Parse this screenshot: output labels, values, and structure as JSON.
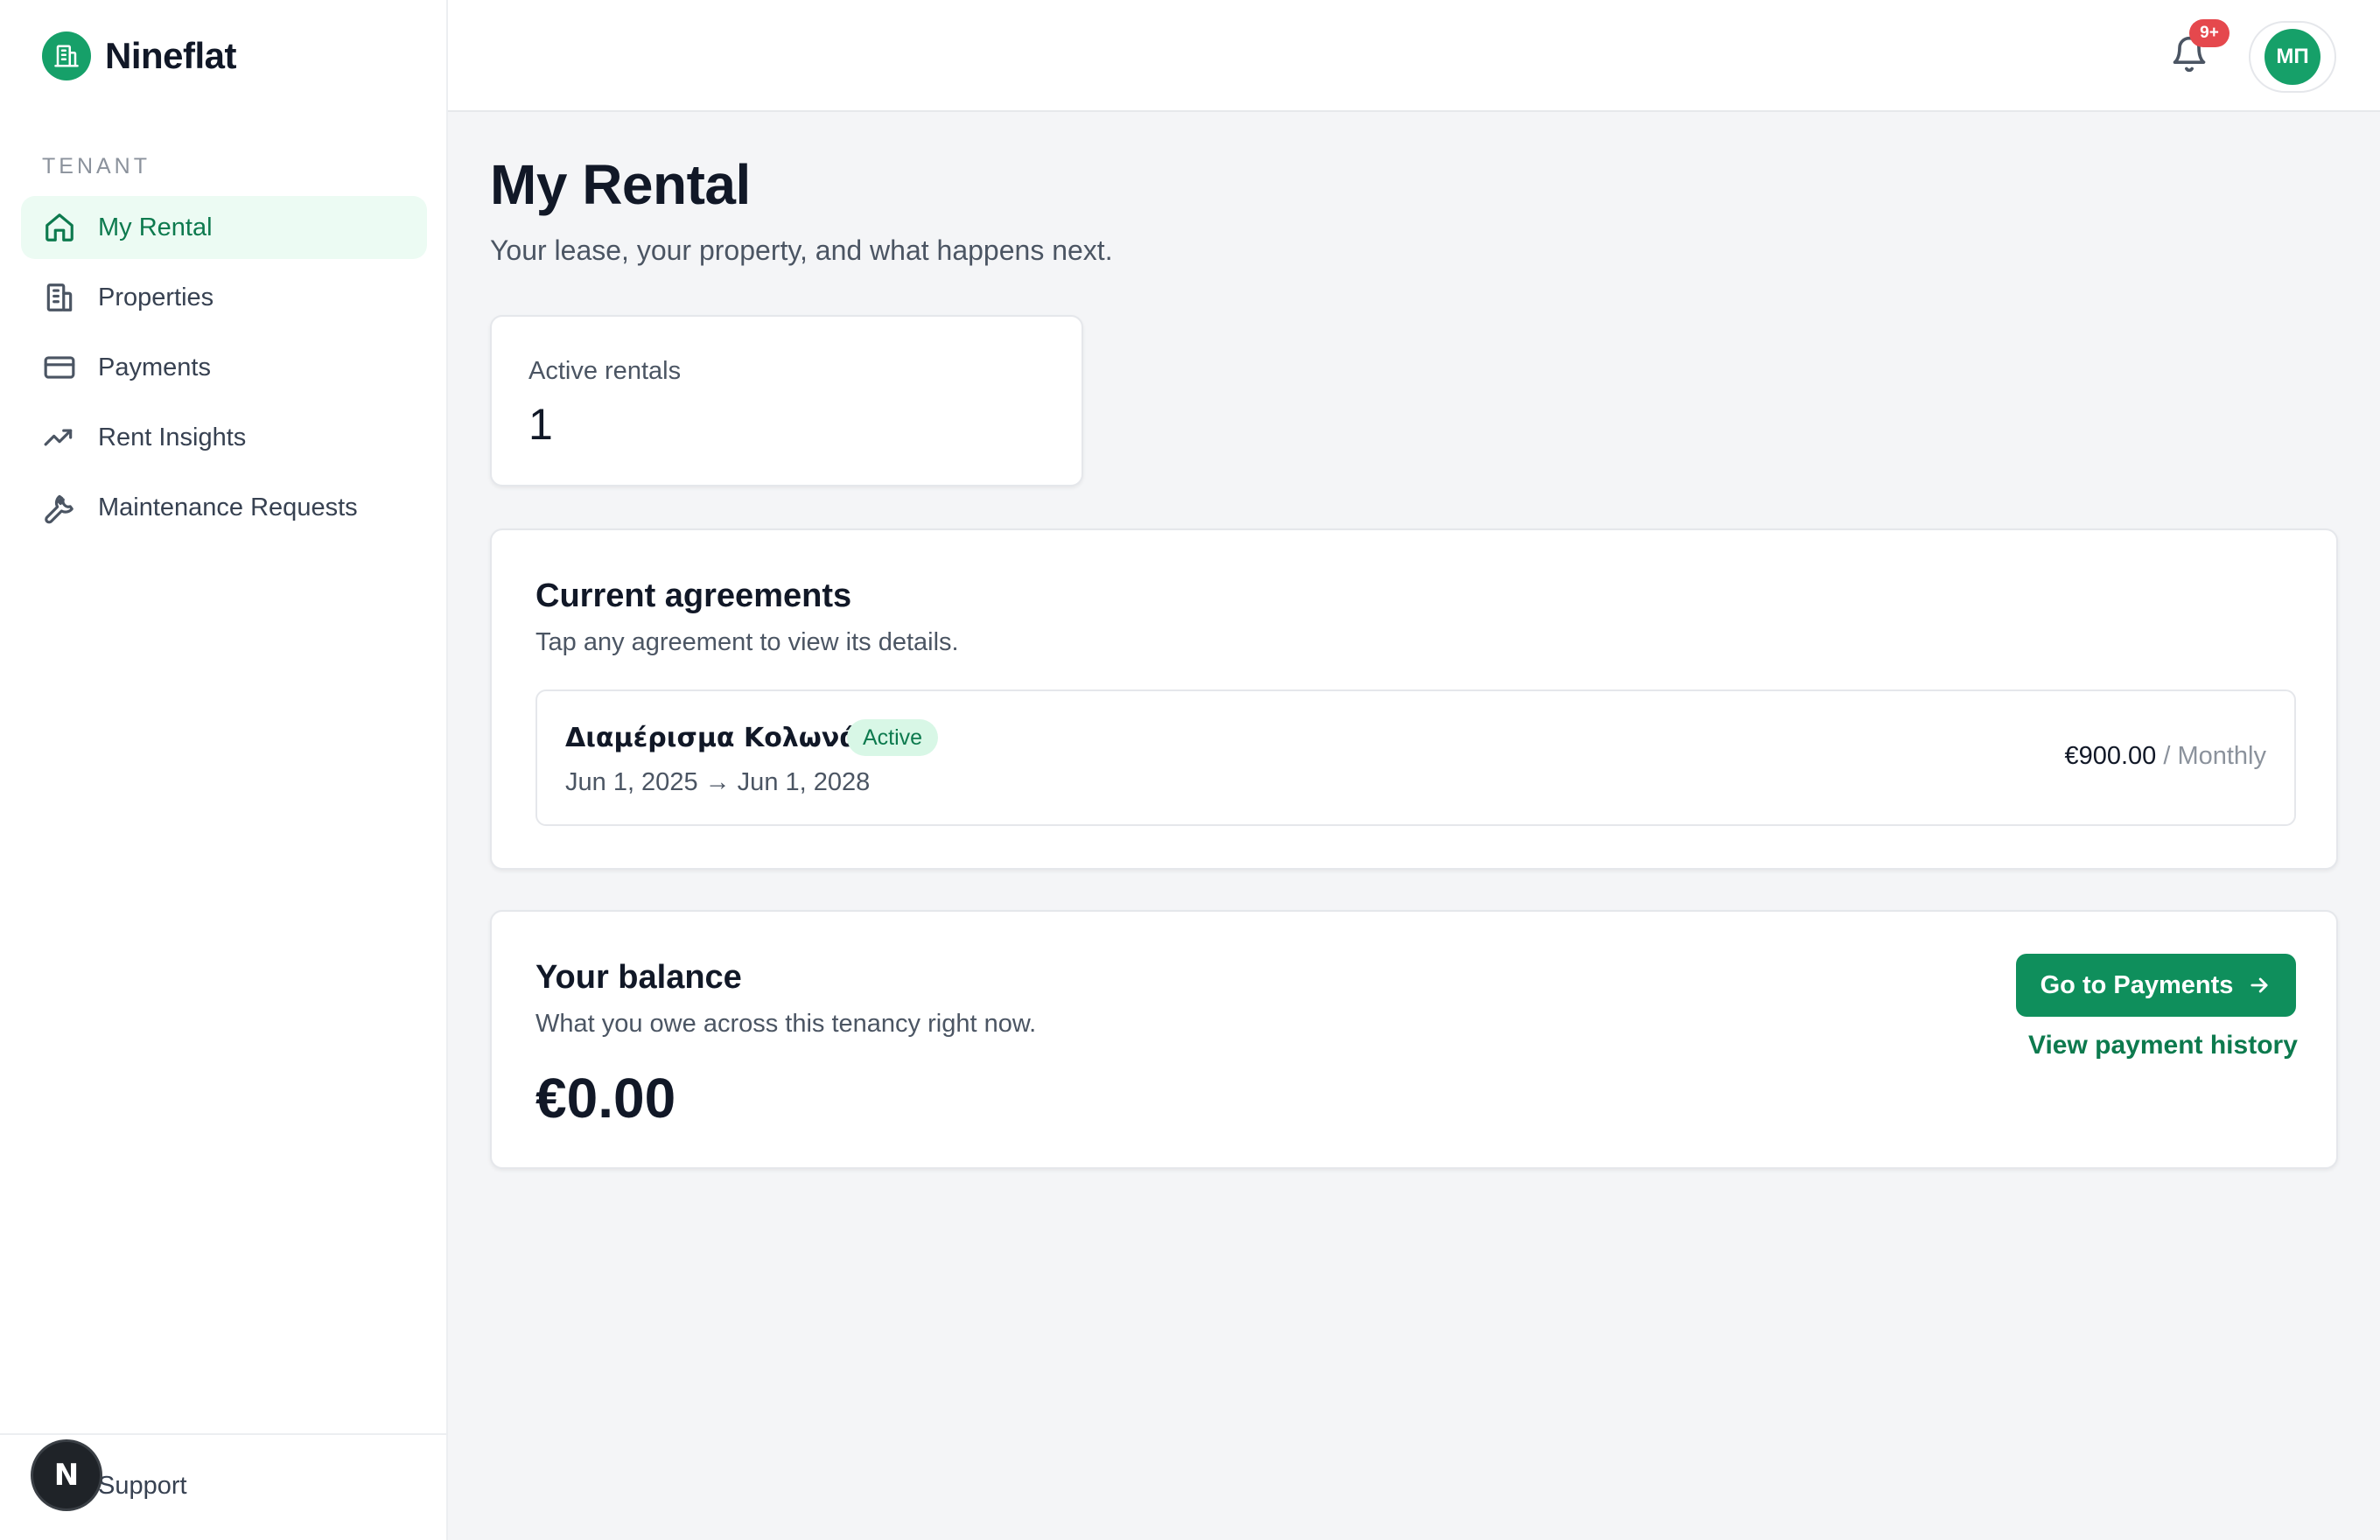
{
  "app": {
    "name": "Nineflat",
    "brand_color": "#16a069"
  },
  "sidebar": {
    "section_label": "TENANT",
    "items": [
      {
        "label": "My Rental",
        "icon": "home-icon",
        "active": true
      },
      {
        "label": "Properties",
        "icon": "building-icon",
        "active": false
      },
      {
        "label": "Payments",
        "icon": "credit-card-icon",
        "active": false
      },
      {
        "label": "Rent Insights",
        "icon": "trending-up-icon",
        "active": false
      },
      {
        "label": "Maintenance Requests",
        "icon": "wrench-icon",
        "active": false
      }
    ],
    "footer": {
      "support_label": "Support",
      "dev_badge_letter": "N"
    }
  },
  "header": {
    "notifications_badge": "9+",
    "user_initials": "ΜΠ"
  },
  "page": {
    "title": "My Rental",
    "subtitle": "Your lease, your property, and what happens next."
  },
  "stats": {
    "active_rentals_label": "Active rentals",
    "active_rentals_value": "1"
  },
  "agreements": {
    "title": "Current agreements",
    "description": "Tap any agreement to view its details.",
    "items": [
      {
        "name": "Διαμέρισμα Κολωνάκι",
        "status": "Active",
        "dates": "Jun 1, 2025 → Jun 1, 2028",
        "price": "€900.00",
        "period": " / Monthly"
      }
    ]
  },
  "balance": {
    "title": "Your balance",
    "description": "What you owe across this tenancy right now.",
    "amount": "€0.00",
    "primary_button": "Go to Payments",
    "history_link": "View payment history"
  }
}
